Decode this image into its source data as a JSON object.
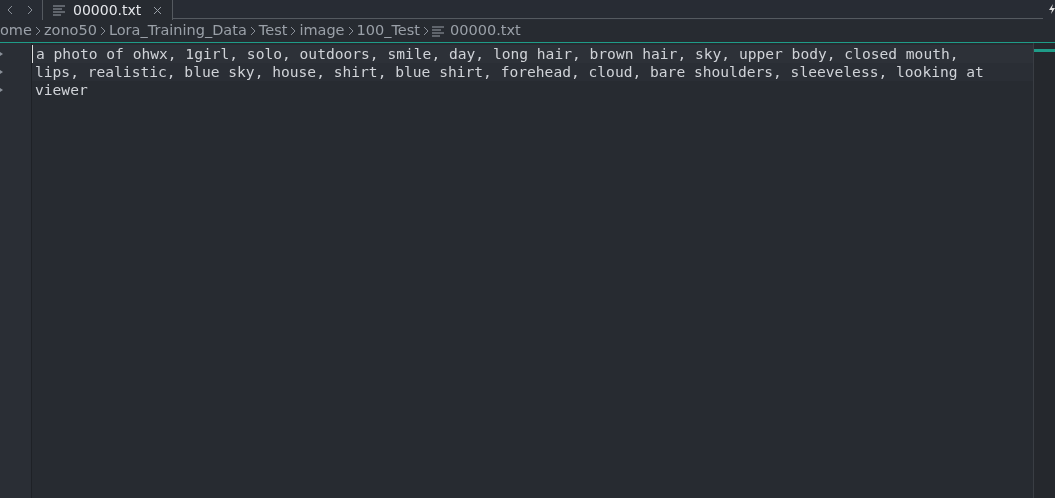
{
  "tabs": [
    {
      "label": "00000.txt",
      "selected": true
    }
  ],
  "breadcrumb": [
    {
      "label": "ome",
      "kind": "folder"
    },
    {
      "label": "zono50",
      "kind": "folder"
    },
    {
      "label": "Lora_Training_Data",
      "kind": "folder"
    },
    {
      "label": "Test",
      "kind": "folder"
    },
    {
      "label": "image",
      "kind": "folder"
    },
    {
      "label": "100_Test",
      "kind": "folder"
    },
    {
      "label": "00000.txt",
      "kind": "file"
    }
  ],
  "editor": {
    "lines": [
      "a photo of ohwx, 1girl, solo, outdoors, smile, day, long hair, brown hair, sky, upper body, closed mouth,",
      "lips, realistic, blue sky, house, shirt, blue shirt, forehead, cloud, bare shoulders, sleeveless, looking at",
      "viewer"
    ]
  }
}
